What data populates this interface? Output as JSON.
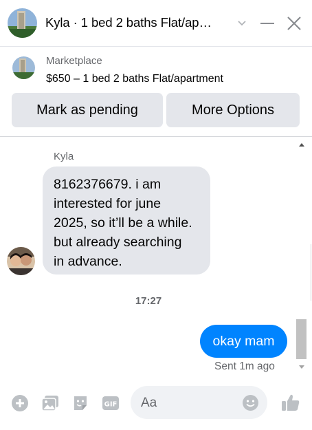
{
  "header": {
    "title": "Kyla · 1 bed 2 baths Flat/ap…"
  },
  "marketplace": {
    "label": "Marketplace",
    "listing": "$650 – 1 bed 2 baths Flat/apartment",
    "pending_label": "Mark as pending",
    "more_label": "More Options"
  },
  "conversation": {
    "sender": "Kyla",
    "incoming": "8162376679. i am\ninterested for june\n2025, so it’ll be a while.\nbut already searching\nin advance.",
    "timestamp": "17:27",
    "outgoing": "okay mam",
    "status": "Sent 1m ago"
  },
  "composer": {
    "placeholder": "Aa",
    "icons": [
      "plus-icon",
      "photo-icon",
      "sticker-icon",
      "gif-icon",
      "emoji-icon",
      "like-icon"
    ]
  },
  "colors": {
    "accent": "#0084ff",
    "bubble_gray": "#e4e6eb",
    "secondary_text": "#65676b",
    "icon_gray": "#bcc0c4"
  }
}
